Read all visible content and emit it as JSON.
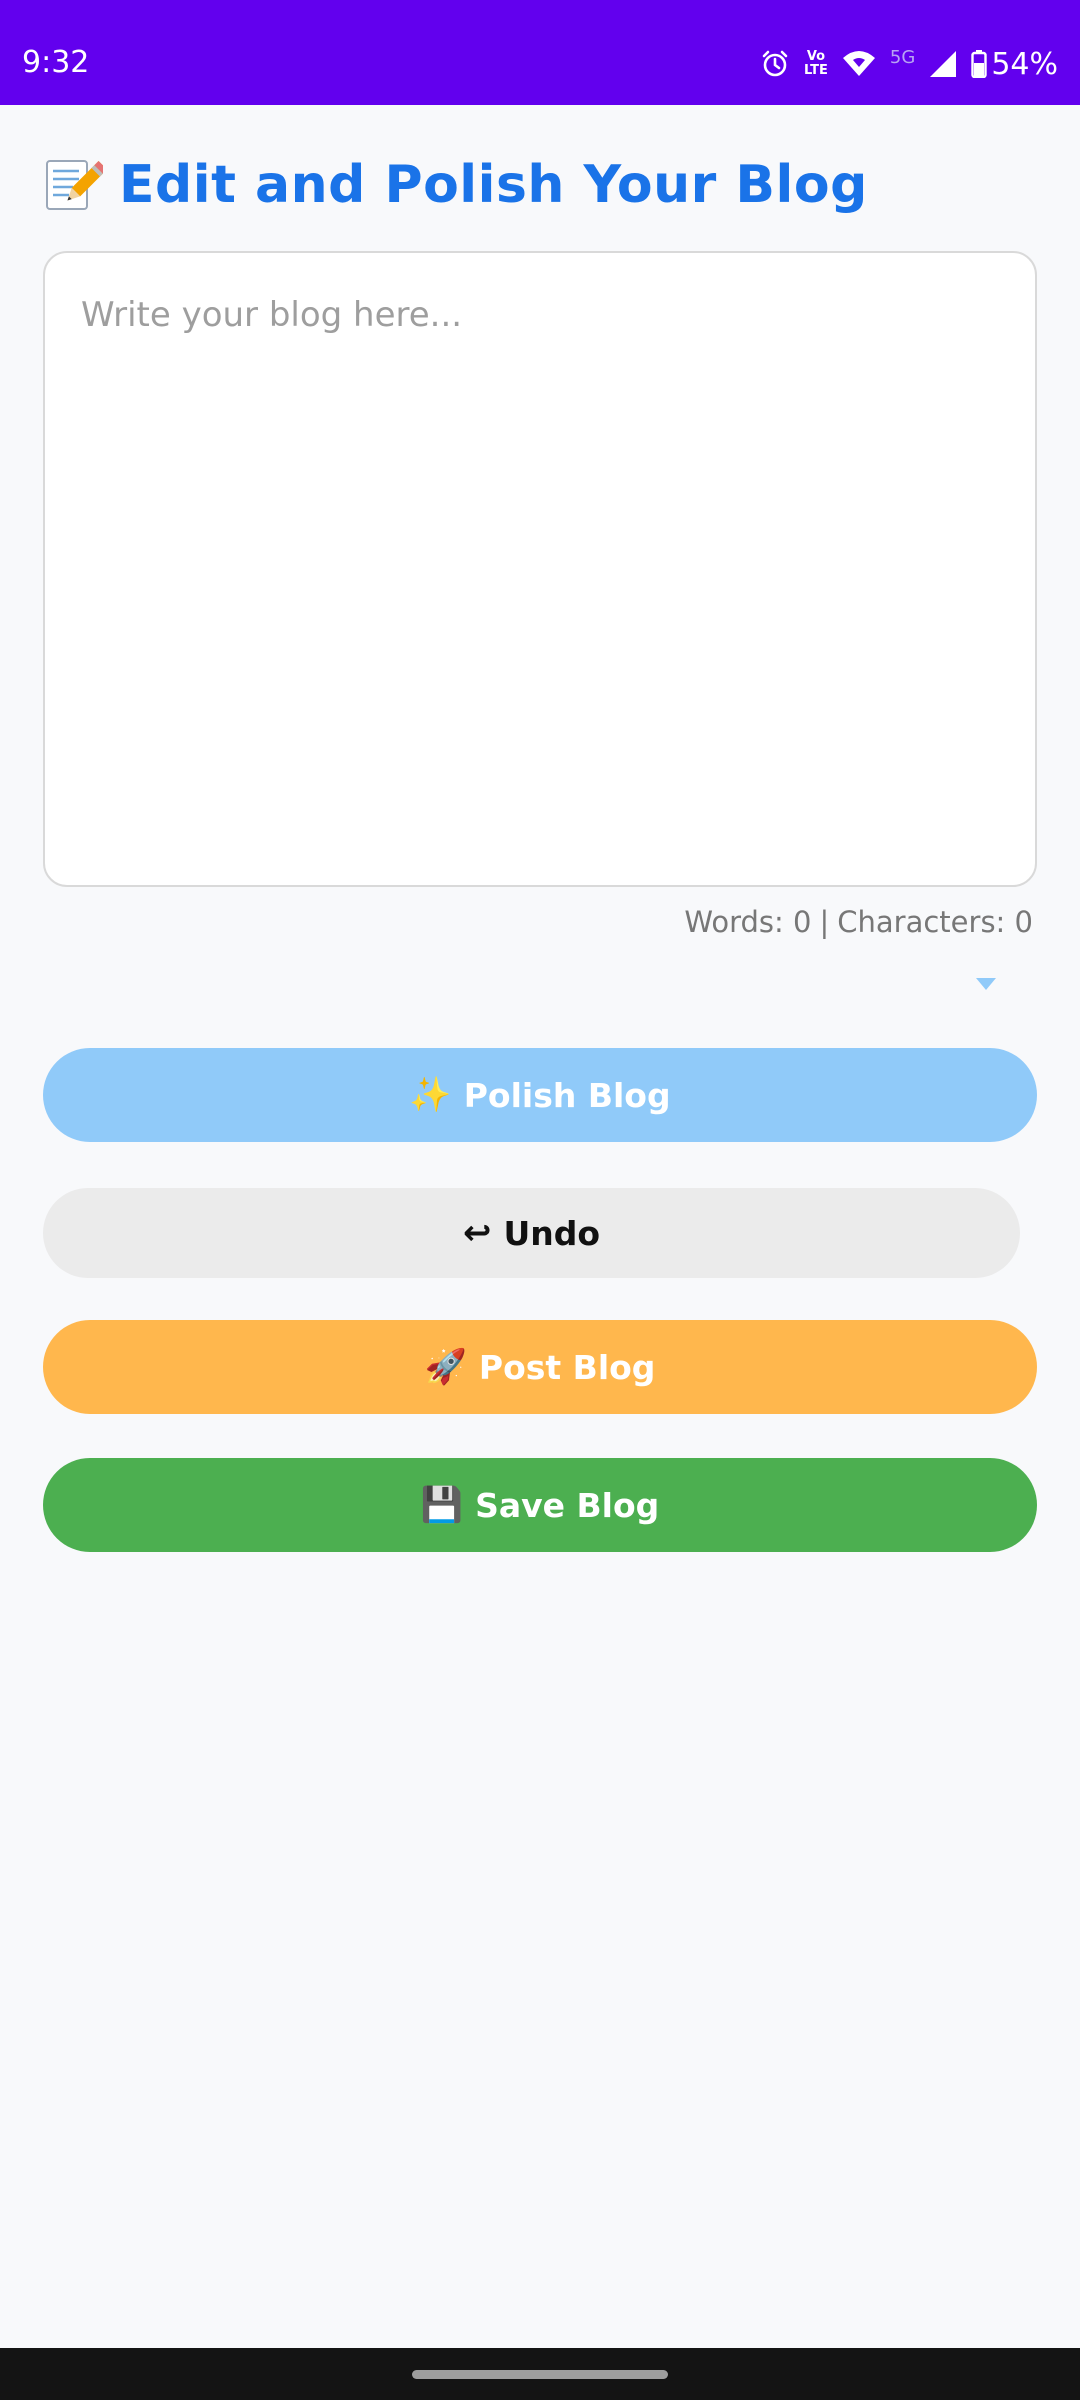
{
  "status_bar": {
    "time": "9:32",
    "volte_top": "Vo",
    "volte_bottom": "LTE",
    "network_label": "5G",
    "battery": "54%",
    "icons": [
      "alarm-icon",
      "volte-icon",
      "wifi-icon",
      "signal-icon",
      "battery-icon"
    ]
  },
  "header": {
    "icon": "memo-pencil-icon",
    "title": "Edit and Polish Your Blog"
  },
  "editor": {
    "value": "",
    "placeholder": "Write your blog here..."
  },
  "counter": {
    "words_label": "Words: 0",
    "separator": "|",
    "chars_label": "Characters: 0"
  },
  "dropdown": {
    "icon": "caret-down-icon",
    "color": "#90caf9"
  },
  "buttons": {
    "polish": {
      "emoji": "✨",
      "label": "Polish Blog",
      "color": "#90caf9"
    },
    "undo": {
      "emoji": "↩",
      "label": "Undo",
      "color": "#ebebeb"
    },
    "post": {
      "emoji": "🚀",
      "label": "Post Blog",
      "color": "#ffb74d"
    },
    "save": {
      "emoji": "💾",
      "label": "Save Blog",
      "color": "#4caf50"
    }
  },
  "colors": {
    "status_bar": "#6200ee",
    "title": "#1a73e8",
    "background": "#f8f9fb"
  }
}
